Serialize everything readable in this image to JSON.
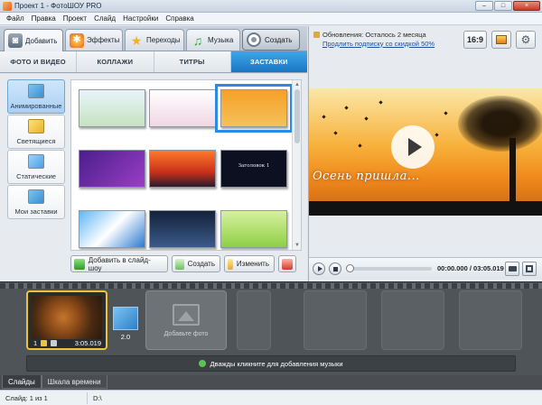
{
  "window": {
    "title": "Проект 1 - ФотоШОУ PRO",
    "min": "–",
    "max": "□",
    "close": "×"
  },
  "menu": [
    "Файл",
    "Правка",
    "Проект",
    "Слайд",
    "Настройки",
    "Справка"
  ],
  "main_tabs": [
    {
      "label": "Добавить",
      "icon": "camera-icon"
    },
    {
      "label": "Эффекты",
      "icon": "palette-icon"
    },
    {
      "label": "Переходы",
      "icon": "star-icon"
    },
    {
      "label": "Музыка",
      "icon": "music-note-icon"
    },
    {
      "label": "Создать",
      "icon": "film-reel-icon"
    }
  ],
  "sub_tabs": [
    "ФОТО И ВИДЕО",
    "КОЛЛАЖИ",
    "ТИТРЫ",
    "ЗАСТАВКИ"
  ],
  "categories": [
    "Анимированные",
    "Светящиеся",
    "Статические",
    "Мои заставки"
  ],
  "thumbnails": [
    {
      "label": "",
      "bg": "linear-gradient(#e9f3fb,#c7e2c0)"
    },
    {
      "label": "",
      "bg": "linear-gradient(#ffffff,#f0d7e4)"
    },
    {
      "label": "",
      "bg": "linear-gradient(#f7a028,#f3c25a)"
    },
    {
      "label": "",
      "bg": "linear-gradient(135deg,#4a1e8a,#9a3ec6)"
    },
    {
      "label": "",
      "bg": "linear-gradient(#ff7a2a,#c8301a 60%,#2a1a2a)"
    },
    {
      "label": "Заголовок 1",
      "bg": "#0c1020"
    },
    {
      "label": "",
      "bg": "linear-gradient(135deg,#5fb8f2,#ffffff 50%,#2a7bcf)"
    },
    {
      "label": "",
      "bg": "linear-gradient(#14213a,#3b5a8a)"
    },
    {
      "label": "",
      "bg": "linear-gradient(#d6f0a0,#8ed044)"
    }
  ],
  "actions": {
    "add": "Добавить в слайд-шоу",
    "create": "Создать",
    "edit": "Изменить"
  },
  "notice": {
    "update": "Обновления: Осталось 2 месяца",
    "link": "Продлить подписку со скидкой 50%"
  },
  "aspect_label": "16:9",
  "preview_title": "Осень пришла...",
  "player": {
    "time": "00:00.000 / 03:05.019"
  },
  "timeline": {
    "slide_number": "1",
    "slide_duration": "3:05.019",
    "transition_duration": "2.0",
    "add_photo_label": "Добавьте фото",
    "music_hint": "Дважды кликните для добавления музыки"
  },
  "bottom_tabs": [
    "Слайды",
    "Шкала времени"
  ],
  "status": {
    "slide": "Слайд: 1 из 1",
    "path": "D:\\"
  },
  "colors": {
    "accent": "#1f86d8",
    "selected_slide": "#f0c23a",
    "filmstrip": "#4f5459"
  }
}
